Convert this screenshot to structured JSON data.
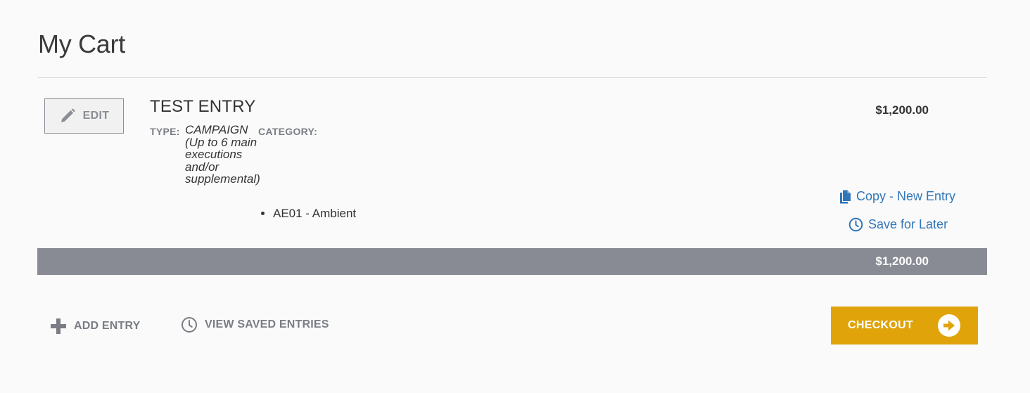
{
  "page": {
    "title": "My Cart"
  },
  "cart_item": {
    "edit_label": "EDIT",
    "name": "TEST ENTRY",
    "type_label": "TYPE:",
    "type_value": "CAMPAIGN (Up to 6 main executions and/or supplemental)",
    "category_label": "CATEGORY:",
    "categories": [
      "AE01 - Ambient"
    ],
    "price": "$1,200.00",
    "copy_label": "Copy - New Entry",
    "save_later_label": "Save for Later"
  },
  "total": {
    "amount": "$1,200.00"
  },
  "footer": {
    "add_entry_label": "ADD ENTRY",
    "view_saved_label": "VIEW SAVED ENTRIES",
    "checkout_label": "CHECKOUT"
  },
  "colors": {
    "accent_link": "#2f76b8",
    "checkout": "#e0a30a",
    "total_bar": "#888b93",
    "muted_text": "#7a7d85"
  },
  "icons": {
    "edit": "pencil-icon",
    "copy": "copy-icon",
    "save_later": "clock-icon",
    "add_entry": "plus-icon",
    "view_saved": "clock-icon",
    "checkout": "arrow-right-circle-icon"
  }
}
